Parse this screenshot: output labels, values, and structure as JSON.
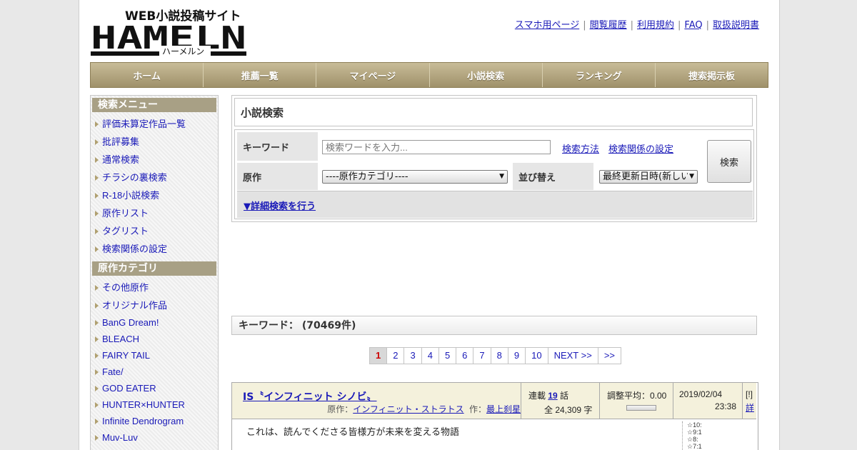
{
  "header": {
    "logo_tagline": "WEB小説投稿サイト",
    "logo_text": "HAMELN",
    "logo_kana": "ハーメルン",
    "links": [
      "スマホ用ページ",
      "閲覧履歴",
      "利用規約",
      "FAQ",
      "取扱説明書"
    ]
  },
  "nav": [
    "ホーム",
    "推薦一覧",
    "マイページ",
    "小説検索",
    "ランキング",
    "捜索掲示板"
  ],
  "sidebar": {
    "menu_title": "検索メニュー",
    "menu_items": [
      "評価未算定作品一覧",
      "批評募集",
      "通常検索",
      "チラシの裏検索",
      "R-18小説検索",
      "原作リスト",
      "タグリスト",
      "検索関係の設定"
    ],
    "category_title": "原作カテゴリ",
    "category_items": [
      "その他原作",
      "オリジナル作品",
      "BanG Dream!",
      "BLEACH",
      "FAIRY TAIL",
      "Fate/",
      "GOD EATER",
      "HUNTER×HUNTER",
      "Infinite Dendrogram",
      "Muv-Luv"
    ]
  },
  "search": {
    "title": "小説検索",
    "keyword_label": "キーワード",
    "keyword_placeholder": "検索ワードを入力...",
    "method_link": "検索方法",
    "settings_link": "検索関係の設定",
    "genre_label": "原作",
    "genre_value": "----原作カテゴリ----",
    "sort_label": "並び替え",
    "sort_value": "最終更新日時(新しい",
    "submit": "検索",
    "detail_link": "▼詳細検索を行う"
  },
  "results": {
    "heading": "キーワード： (70469件)",
    "pages": [
      "1",
      "2",
      "3",
      "4",
      "5",
      "6",
      "7",
      "8",
      "9",
      "10",
      "NEXT >>",
      ">>"
    ],
    "current_page": "1"
  },
  "novel": {
    "title": "IS〝インフィニット シノビ〟",
    "original_label": "原作：",
    "original": "インフィニット・ストラトス",
    "author_label": "作：",
    "author": "最上刹星",
    "serial_label": "連載",
    "episodes": "19",
    "episodes_unit": "話",
    "chars": "全 24,309 字",
    "rating": "調整平均：0.00",
    "date": "2019/02/04",
    "time": "23:38",
    "flag": "[!]",
    "detail": "詳",
    "description": "これは、読んでくださる皆様方が未来を変える物語",
    "stars": [
      "☆10:",
      "☆9:1",
      "☆8:",
      "☆7:1"
    ]
  }
}
